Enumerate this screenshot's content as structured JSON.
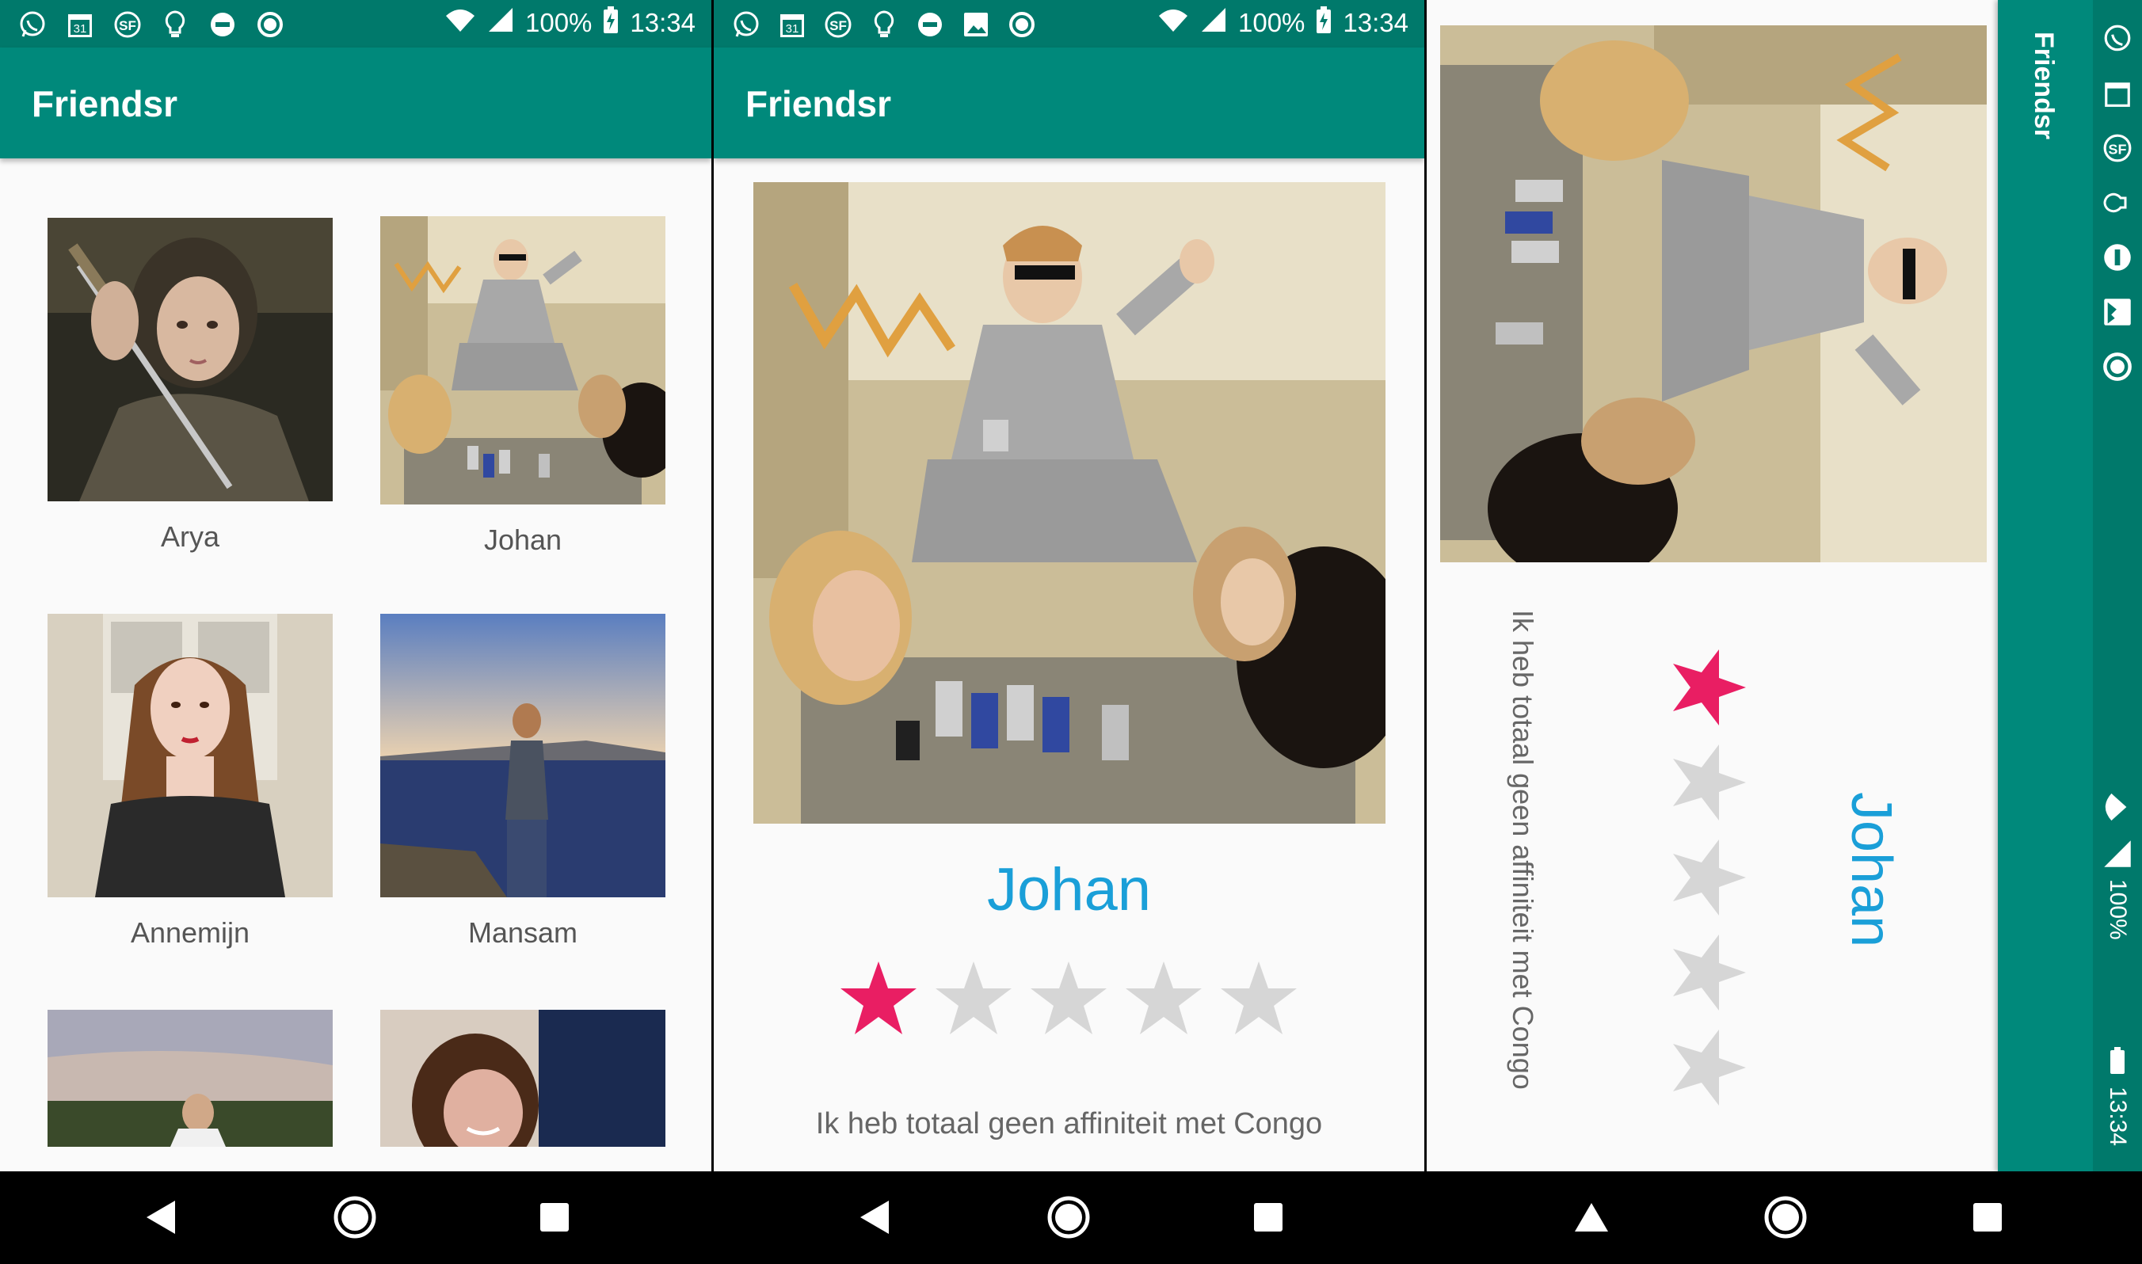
{
  "app": {
    "title": "Friendsr"
  },
  "status_bar": {
    "battery": "100%",
    "time": "13:34",
    "calendar_day": "31"
  },
  "friends": [
    {
      "name": "Arya"
    },
    {
      "name": "Johan"
    },
    {
      "name": "Annemijn"
    },
    {
      "name": "Mansam"
    },
    {
      "name": ""
    },
    {
      "name": ""
    }
  ],
  "detail": {
    "name": "Johan",
    "rating": 1,
    "max_rating": 5,
    "bio": "Ik heb totaal geen affiniteit met Congo"
  },
  "colors": {
    "primary": "#00897b",
    "primary_dark": "#00796b",
    "accent": "#e91e63",
    "name_text": "#1a9fd8",
    "star_empty": "#d6d6d6"
  },
  "icons": {
    "status_left": [
      "whatsapp-icon",
      "calendar-icon",
      "sf-icon",
      "lightbulb-icon",
      "dnd-icon",
      "circle-icon"
    ],
    "status_left_p2": [
      "whatsapp-icon",
      "calendar-icon",
      "sf-icon",
      "lightbulb-icon",
      "dnd-icon",
      "image-icon",
      "circle-icon"
    ],
    "nav": [
      "back-icon",
      "home-icon",
      "recents-icon"
    ]
  }
}
